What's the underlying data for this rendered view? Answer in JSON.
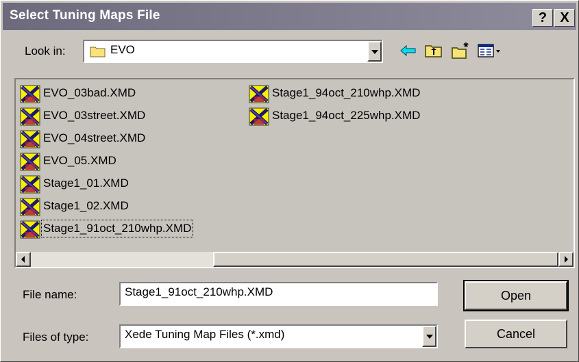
{
  "window": {
    "title": "Select Tuning Maps File",
    "help_label": "?",
    "close_label": "X"
  },
  "look_in": {
    "label": "Look in:",
    "value": "EVO"
  },
  "toolbar": {
    "back_icon": "back-arrow-icon",
    "up_icon": "up-folder-icon",
    "new_folder_icon": "new-folder-icon",
    "view_icon": "view-menu-icon"
  },
  "files": [
    "EVO_03bad.XMD",
    "EVO_03street.XMD",
    "EVO_04street.XMD",
    "EVO_05.XMD",
    "Stage1_01.XMD",
    "Stage1_02.XMD",
    "Stage1_91oct_210whp.XMD",
    "Stage1_94oct_210whp.XMD",
    "Stage1_94oct_225whp.XMD"
  ],
  "selected_file": "Stage1_91oct_210whp.XMD",
  "file_name": {
    "label": "File name:",
    "value": "Stage1_91oct_210whp.XMD"
  },
  "file_type": {
    "label": "Files of type:",
    "value": "Xede Tuning Map Files (*.xmd)"
  },
  "buttons": {
    "open": "Open",
    "cancel": "Cancel"
  },
  "colors": {
    "titlebar": "#6c6a7c",
    "face": "#c9c4be",
    "list_bg": "#c7c3bd"
  }
}
